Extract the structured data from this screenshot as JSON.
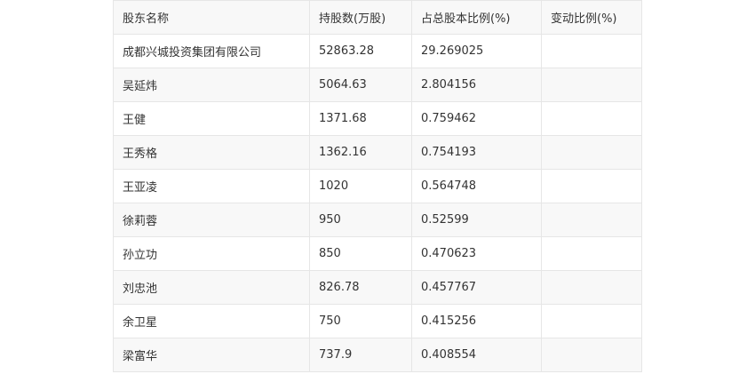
{
  "table": {
    "headers": [
      "股东名称",
      "持股数(万股)",
      "占总股本比例(%)",
      "变动比例(%)"
    ],
    "rows": [
      [
        "成都兴城投资集团有限公司",
        "52863.28",
        "29.269025",
        ""
      ],
      [
        "吴延炜",
        "5064.63",
        "2.804156",
        ""
      ],
      [
        "王健",
        "1371.68",
        "0.759462",
        ""
      ],
      [
        "王秀格",
        "1362.16",
        "0.754193",
        ""
      ],
      [
        "王亚凌",
        "1020",
        "0.564748",
        ""
      ],
      [
        "徐莉蓉",
        "950",
        "0.52599",
        ""
      ],
      [
        "孙立功",
        "850",
        "0.470623",
        ""
      ],
      [
        "刘忠池",
        "826.78",
        "0.457767",
        ""
      ],
      [
        "余卫星",
        "750",
        "0.415256",
        ""
      ],
      [
        "梁富华",
        "737.9",
        "0.408554",
        ""
      ]
    ]
  }
}
